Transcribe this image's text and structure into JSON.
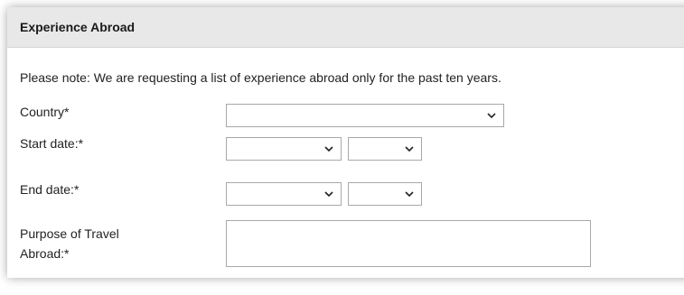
{
  "panel": {
    "title": "Experience Abroad"
  },
  "note": "Please note: We are requesting a list of experience abroad only for the past ten years.",
  "fields": {
    "country": {
      "label": "Country*",
      "value": ""
    },
    "start_date": {
      "label": "Start date:*",
      "month": "",
      "year": ""
    },
    "end_date": {
      "label": "End date:*",
      "month": "",
      "year": ""
    },
    "purpose": {
      "label_line1": "Purpose of Travel",
      "label_line2": "Abroad:*",
      "value": ""
    }
  },
  "icons": {
    "dropdown": "chevron-down-icon"
  }
}
